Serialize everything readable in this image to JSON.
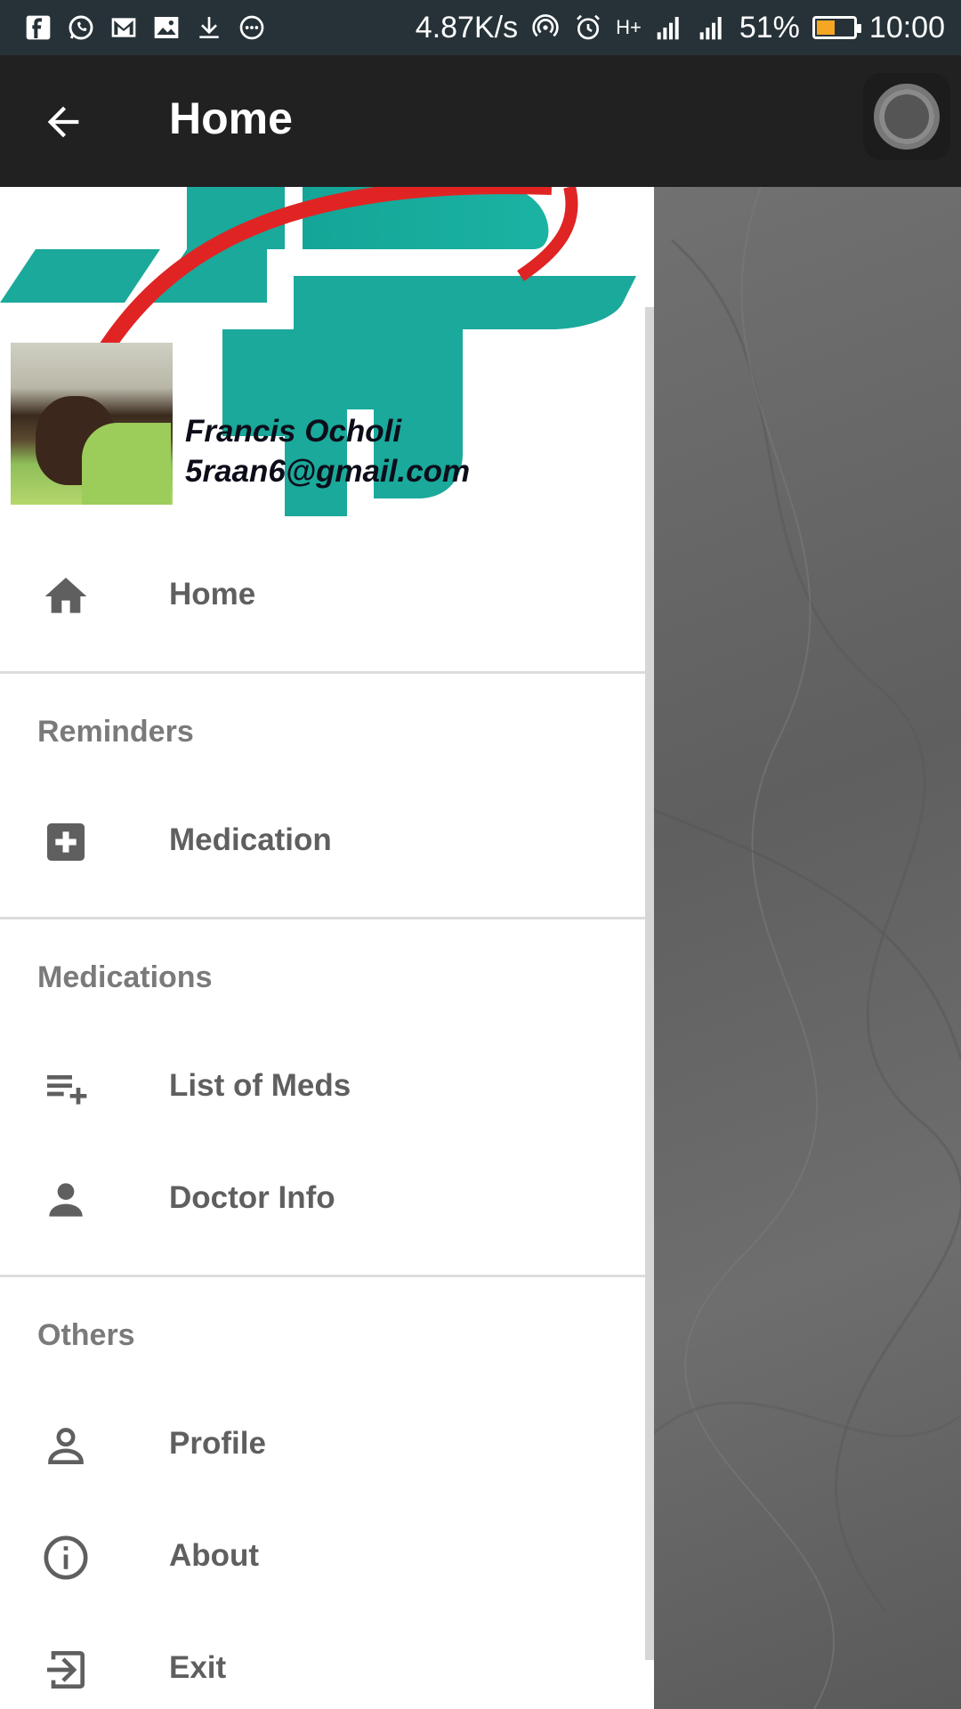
{
  "status_bar": {
    "network_speed": "4.87K/s",
    "network_type": "H+",
    "battery": "51%",
    "battery_level": 0.51,
    "time": "10:00",
    "left_icons": [
      "facebook-icon",
      "whatsapp-icon",
      "gmail-icon",
      "gallery-icon",
      "download-icon",
      "more-icon"
    ],
    "right_icons": [
      "hotspot-icon",
      "alarm-icon",
      "signal-icon",
      "signal-icon"
    ]
  },
  "app_bar": {
    "title": "Home",
    "back_icon": "arrow-back-icon"
  },
  "drawer": {
    "user": {
      "name": "Francis Ocholi",
      "email": "5raan6@gmail.com"
    },
    "items": {
      "home": {
        "label": "Home",
        "icon": "home-icon"
      },
      "medication": {
        "label": "Medication",
        "icon": "medical-plus-icon"
      },
      "list_of_meds": {
        "label": "List of Meds",
        "icon": "playlist-add-icon"
      },
      "doctor_info": {
        "label": "Doctor Info",
        "icon": "person-icon"
      },
      "profile": {
        "label": "Profile",
        "icon": "person-outline-icon"
      },
      "about": {
        "label": "About",
        "icon": "info-icon"
      },
      "exit": {
        "label": "Exit",
        "icon": "exit-icon"
      }
    },
    "sections": {
      "reminders": "Reminders",
      "medications": "Medications",
      "others": "Others"
    }
  },
  "colors": {
    "logo_teal": "#1aa99a",
    "logo_red": "#e02424",
    "app_bar": "#212121",
    "status_bar": "#263238",
    "icon_gray": "#5f5f5f"
  }
}
